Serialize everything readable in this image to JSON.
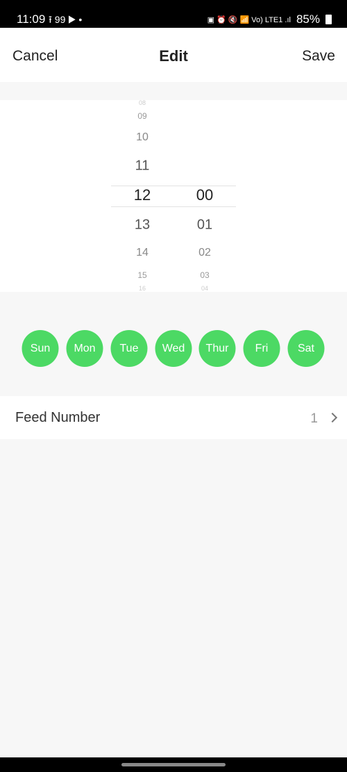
{
  "status_bar": {
    "time": "11:09",
    "left_icons": "⭱ 99 ▶ •",
    "right_icons": "▣ ⏰ 🔇 📶 Vo) LTE1 .ıl",
    "battery": "85%"
  },
  "header": {
    "cancel_label": "Cancel",
    "title": "Edit",
    "save_label": "Save"
  },
  "picker": {
    "hours": [
      "08",
      "09",
      "10",
      "11",
      "12",
      "13",
      "14",
      "15",
      "16"
    ],
    "minutes": [
      "00",
      "01",
      "02",
      "03",
      "04"
    ],
    "selected_hour": "12",
    "selected_minute": "00"
  },
  "days": [
    {
      "label": "Sun",
      "selected": true
    },
    {
      "label": "Mon",
      "selected": true
    },
    {
      "label": "Tue",
      "selected": true
    },
    {
      "label": "Wed",
      "selected": true
    },
    {
      "label": "Thur",
      "selected": true
    },
    {
      "label": "Fri",
      "selected": true
    },
    {
      "label": "Sat",
      "selected": true
    }
  ],
  "accent_color": "#4cd964",
  "feed_number": {
    "label": "Feed Number",
    "value": "1",
    "icon": "chevron-right-icon"
  }
}
